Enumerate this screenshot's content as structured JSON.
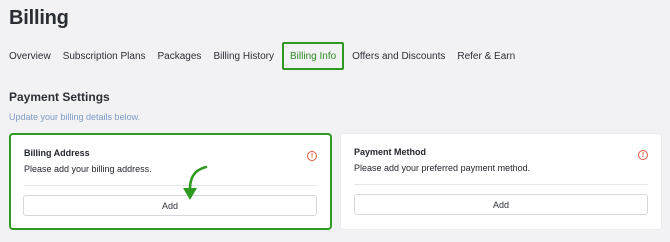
{
  "page": {
    "title": "Billing"
  },
  "tabs": [
    {
      "label": "Overview"
    },
    {
      "label": "Subscription Plans"
    },
    {
      "label": "Packages"
    },
    {
      "label": "Billing History"
    },
    {
      "label": "Billing Info",
      "active": true
    },
    {
      "label": "Offers and Discounts"
    },
    {
      "label": "Refer & Earn"
    }
  ],
  "payment_settings": {
    "title": "Payment Settings",
    "subtitle": "Update your billing details below."
  },
  "billing_address": {
    "title": "Billing Address",
    "description": "Please add your billing address.",
    "button": "Add",
    "alert_icon": "!"
  },
  "payment_method": {
    "title": "Payment Method",
    "description": "Please add your preferred payment method.",
    "button": "Add",
    "alert_icon": "!"
  },
  "colors": {
    "highlight": "#2e9a22",
    "active_tab_text": "#2e8b24",
    "subtitle": "#7f9bc4",
    "alert": "#d9573e"
  },
  "icons": {
    "alert": "alert-circle-icon",
    "annotation": "annotation-arrow-icon"
  }
}
